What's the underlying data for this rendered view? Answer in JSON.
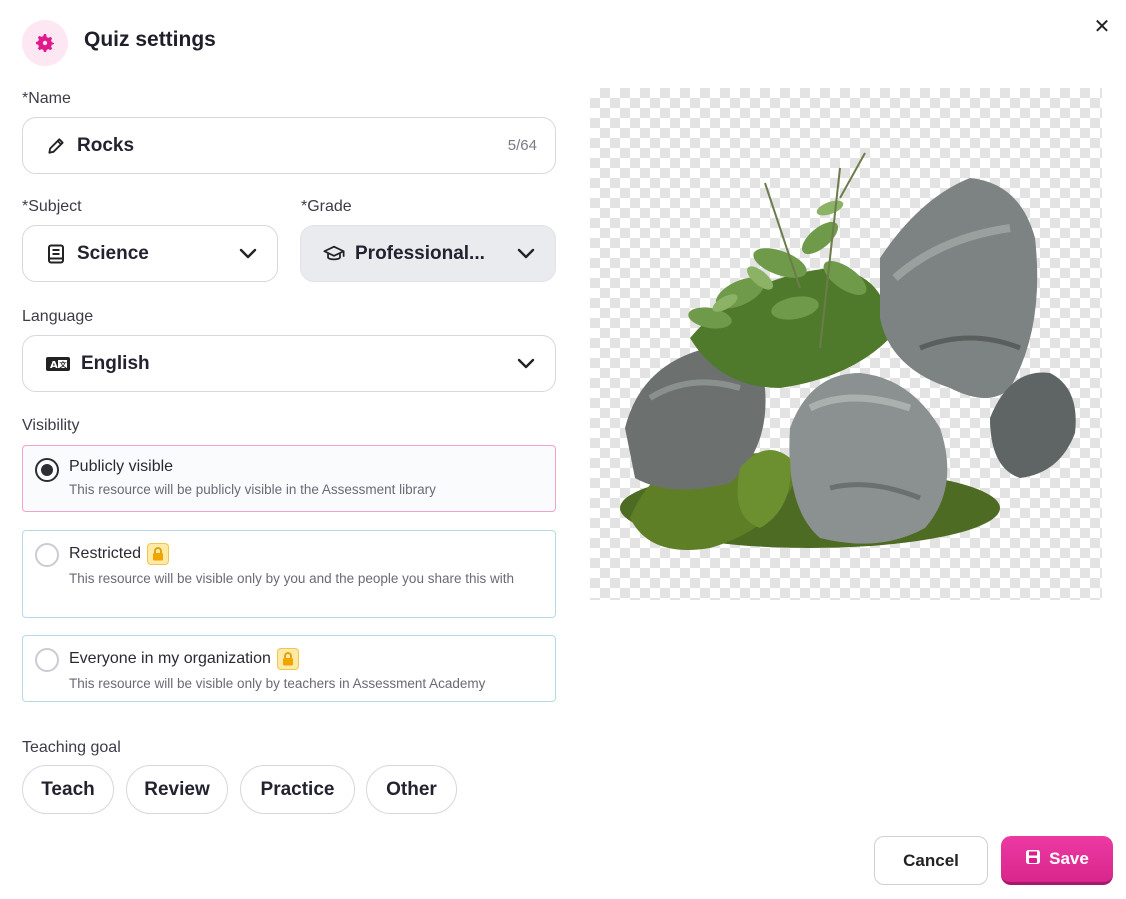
{
  "header": {
    "title": "Quiz settings",
    "icon": "gear-icon",
    "accent": "#e0198c"
  },
  "form": {
    "name": {
      "label": "*Name",
      "value": "Rocks",
      "counter": "5/64",
      "icon": "pencil-icon"
    },
    "subject": {
      "label": "*Subject",
      "value": "Science",
      "icon": "book-icon"
    },
    "grade": {
      "label": "*Grade",
      "value": "Professional...",
      "icon": "graduation-cap-icon"
    },
    "language": {
      "label": "Language",
      "value": "English",
      "icon": "language-icon"
    },
    "visibility": {
      "label": "Visibility",
      "options": [
        {
          "title": "Publicly visible",
          "desc": "This resource will be publicly visible in the Assessment library",
          "selected": true,
          "locked": false
        },
        {
          "title": "Restricted",
          "desc": "This resource will be visible only by you and the people you share this with",
          "selected": false,
          "locked": true
        },
        {
          "title": "Everyone in my organization",
          "desc": "This resource will be visible only by teachers in Assessment Academy",
          "selected": false,
          "locked": true
        }
      ]
    },
    "teaching_goal": {
      "label": "Teaching goal",
      "options": [
        "Teach",
        "Review",
        "Practice",
        "Other"
      ]
    }
  },
  "footer": {
    "cancel_label": "Cancel",
    "save_label": "Save"
  }
}
